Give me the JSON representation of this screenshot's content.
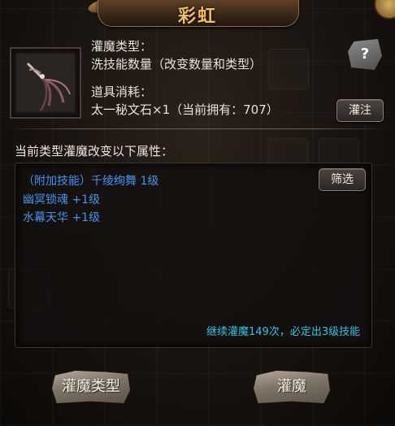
{
  "window": {
    "title": "彩虹"
  },
  "item": {
    "type_label": "灌魔类型：",
    "type_value": "洗技能数量（改变数量和类型）",
    "cost_label": "道具消耗：",
    "cost_value": "太一秘文石×1（当前拥有：707）"
  },
  "buttons": {
    "help": "?",
    "inject": "灌注",
    "filter": "筛选",
    "enchant_type": "灌魔类型",
    "enchant": "灌魔"
  },
  "section": {
    "title": "当前类型灌魔改变以下属性："
  },
  "attributes": [
    {
      "text": "（附加技能）千绫绚舞 1级"
    },
    {
      "text": "幽冥锁魂 +1级"
    },
    {
      "text": "水幕天华 +1级"
    }
  ],
  "footer": {
    "note": "继续灌魔149次，必定出3级技能"
  },
  "colors": {
    "title": "#f0c060",
    "attribute": "#3f95f0",
    "note": "#2fc4e8"
  }
}
